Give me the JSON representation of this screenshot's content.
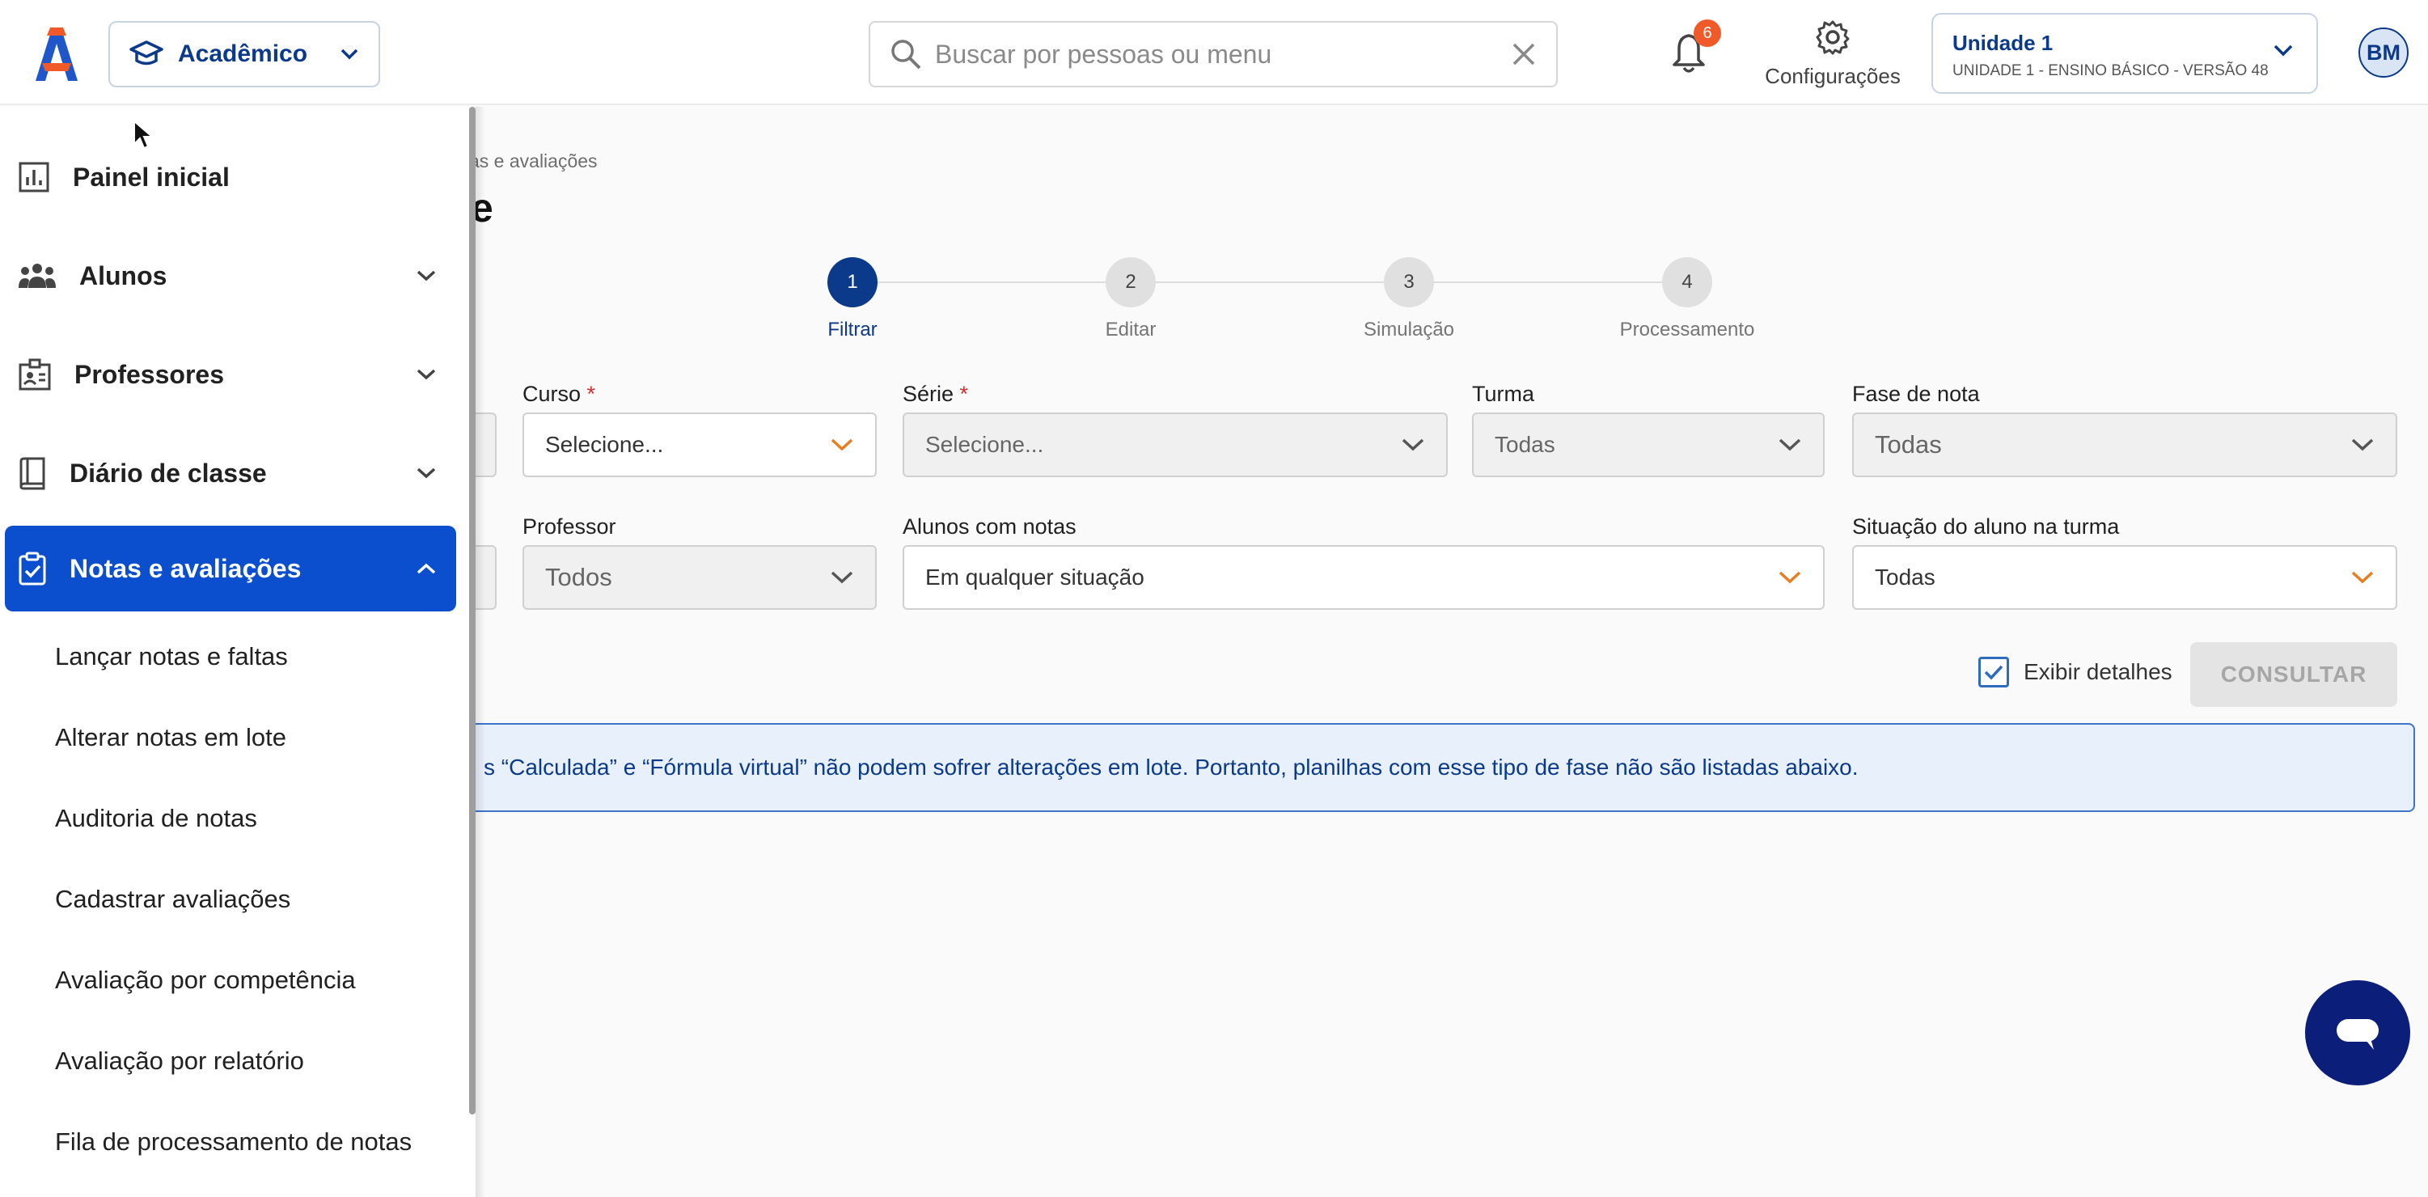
{
  "header": {
    "module_label": "Acadêmico",
    "search_placeholder": "Buscar por pessoas ou menu",
    "notification_count": "6",
    "settings_label": "Configurações",
    "unit_title": "Unidade 1",
    "unit_subtitle": "UNIDADE 1 - ENSINO BÁSICO - VERSÃO 48",
    "avatar_initials": "BM"
  },
  "main": {
    "breadcrumb_fragment": "as e avaliações",
    "title_fragment": "e",
    "steps": [
      {
        "number": "1",
        "label": "Filtrar",
        "active": true
      },
      {
        "number": "2",
        "label": "Editar",
        "active": false
      },
      {
        "number": "3",
        "label": "Simulação",
        "active": false
      },
      {
        "number": "4",
        "label": "Processamento",
        "active": false
      }
    ],
    "filters": {
      "curso_label": "Curso",
      "curso_value": "Selecione...",
      "serie_label": "Série",
      "serie_value": "Selecione...",
      "turma_label": "Turma",
      "turma_value": "Todas",
      "fase_label": "Fase de nota",
      "fase_value": "Todas",
      "professor_label": "Professor",
      "professor_value": "Todos",
      "alunos_label": "Alunos com notas",
      "alunos_value": "Em qualquer situação",
      "situacao_label": "Situação do aluno na turma",
      "situacao_value": "Todas",
      "required_mark": "*"
    },
    "show_details_label": "Exibir detalhes",
    "consult_label": "CONSULTAR",
    "alert_text": "s “Calculada” e “Fórmula virtual” não podem sofrer alterações em lote. Portanto, planilhas com esse tipo de fase não são listadas abaixo."
  },
  "sidebar": {
    "items": [
      {
        "label": "Painel inicial"
      },
      {
        "label": "Alunos"
      },
      {
        "label": "Professores"
      },
      {
        "label": "Diário de classe"
      },
      {
        "label": "Notas e avaliações"
      }
    ],
    "sub_items": [
      "Lançar notas e faltas",
      "Alterar notas em lote",
      "Auditoria de notas",
      "Cadastrar avaliações",
      "Avaliação por competência",
      "Avaliação por relatório",
      "Fila de processamento de notas"
    ]
  },
  "colors": {
    "brand": "#0b3a8a",
    "active_menu": "#0b4fce",
    "accent_orange": "#f05a28",
    "chat_button": "#0b1f7a"
  }
}
